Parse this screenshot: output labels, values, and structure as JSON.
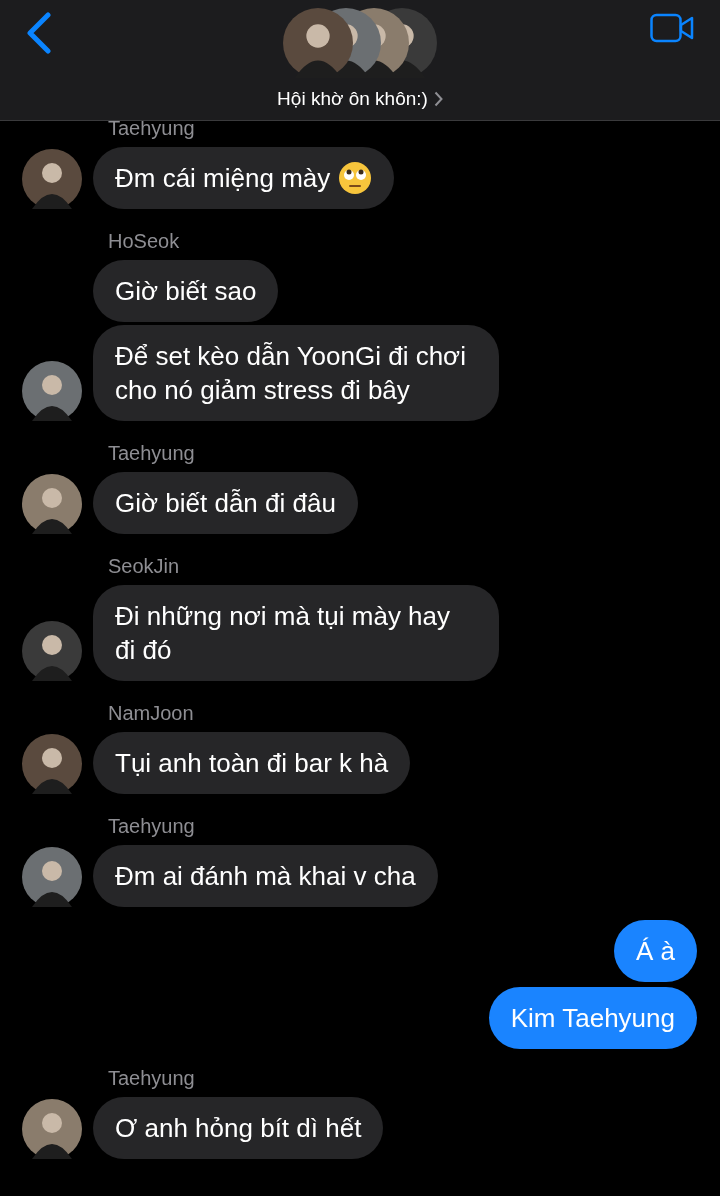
{
  "header": {
    "title": "Hội khờ ôn khôn:)"
  },
  "messages": [
    {
      "kind": "sender",
      "text": "Taehyung"
    },
    {
      "kind": "incoming",
      "text": "Đm cái miệng mày",
      "avatar": true,
      "emoji": true
    },
    {
      "kind": "sender",
      "text": "HoSeok"
    },
    {
      "kind": "incoming",
      "text": "Giờ biết sao",
      "avatar": false
    },
    {
      "kind": "incoming",
      "text": "Để set kèo dẫn YoonGi đi chơi cho nó giảm stress đi bây",
      "avatar": true
    },
    {
      "kind": "sender",
      "text": "Taehyung"
    },
    {
      "kind": "incoming",
      "text": "Giờ biết dẫn đi đâu",
      "avatar": true
    },
    {
      "kind": "sender",
      "text": "SeokJin"
    },
    {
      "kind": "incoming",
      "text": "Đi những nơi mà tụi mày hay đi đó",
      "avatar": true
    },
    {
      "kind": "sender",
      "text": "NamJoon"
    },
    {
      "kind": "incoming",
      "text": "Tụi anh toàn đi bar k hà",
      "avatar": true
    },
    {
      "kind": "sender",
      "text": "Taehyung"
    },
    {
      "kind": "incoming",
      "text": "Đm ai đánh mà khai v cha",
      "avatar": true
    },
    {
      "kind": "outgoing",
      "text": "Á à"
    },
    {
      "kind": "outgoing",
      "text": "Kim Taehyung"
    },
    {
      "kind": "sender",
      "text": "Taehyung"
    },
    {
      "kind": "incoming",
      "text": "Ơ anh hỏng bít dì hết",
      "avatar": true
    }
  ]
}
